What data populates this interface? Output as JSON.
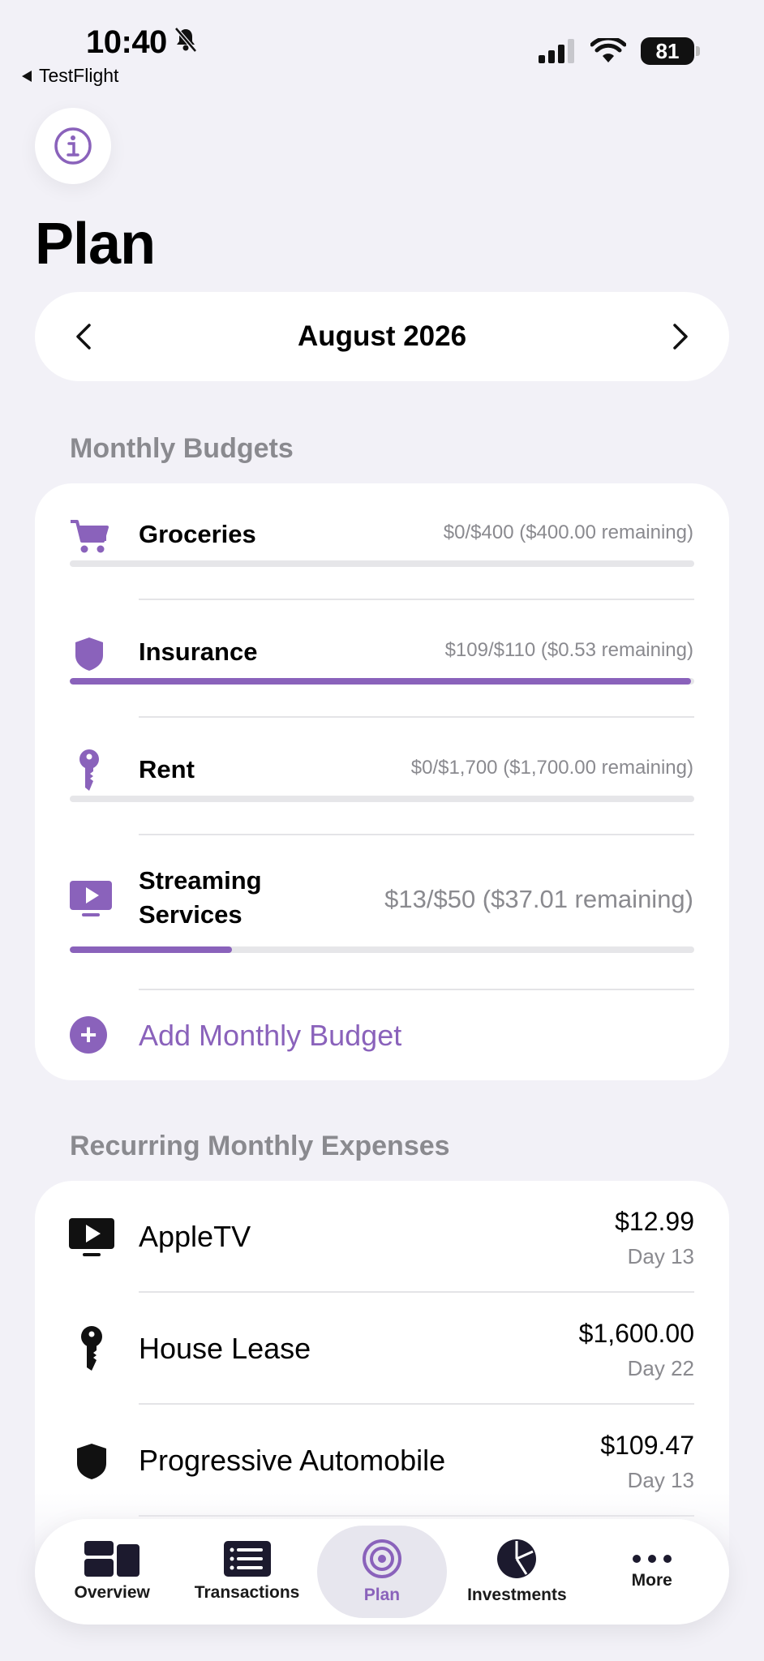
{
  "status_bar": {
    "time": "10:40",
    "back_app": "TestFlight",
    "battery": "81"
  },
  "header": {
    "title": "Plan",
    "info_icon": "info-circle-icon"
  },
  "month_selector": {
    "label": "August 2026"
  },
  "monthly_budgets": {
    "section_title": "Monthly Budgets",
    "items": [
      {
        "name": "Groceries",
        "amount": "$0/$400 ($400.00 remaining)",
        "progress": 0.0,
        "icon": "cart-icon"
      },
      {
        "name": "Insurance",
        "amount": "$109/$110 ($0.53 remaining)",
        "progress": 0.995,
        "icon": "shield-icon"
      },
      {
        "name": "Rent",
        "amount": "$0/$1,700 ($1,700.00 remaining)",
        "progress": 0.0,
        "icon": "key-icon"
      },
      {
        "name": "Streaming\nServices",
        "amount": "$13/$50 ($37.01 remaining)",
        "progress": 0.26,
        "icon": "play-tv-icon"
      }
    ],
    "add_label": "Add Monthly Budget"
  },
  "recurring_expenses": {
    "section_title": "Recurring Monthly Expenses",
    "items": [
      {
        "name": "AppleTV",
        "amount": "$12.99",
        "day": "Day 13",
        "icon": "play-tv-icon"
      },
      {
        "name": "House Lease",
        "amount": "$1,600.00",
        "day": "Day 22",
        "icon": "key-icon"
      },
      {
        "name": "Progressive Automobile",
        "amount": "$109.47",
        "day": "Day 13",
        "icon": "shield-icon"
      }
    ]
  },
  "tab_bar": {
    "tabs": [
      {
        "label": "Overview",
        "icon": "overview-icon"
      },
      {
        "label": "Transactions",
        "icon": "list-icon"
      },
      {
        "label": "Plan",
        "icon": "target-icon",
        "active": true
      },
      {
        "label": "Investments",
        "icon": "pie-chart-icon"
      },
      {
        "label": "More",
        "icon": "ellipsis-icon"
      }
    ]
  },
  "colors": {
    "accent": "#8a62bb",
    "background": "#f2f1f7",
    "secondary_text": "#8a8a8f"
  }
}
